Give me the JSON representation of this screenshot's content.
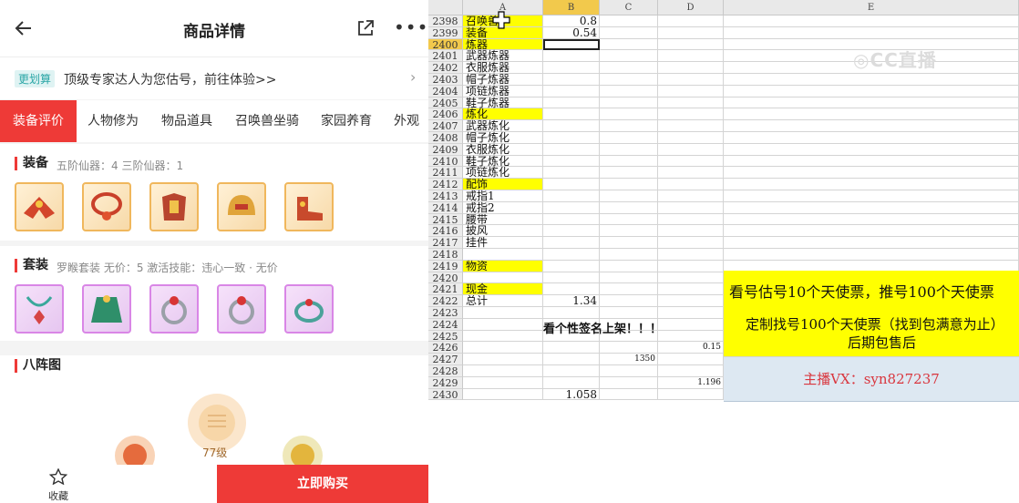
{
  "phone": {
    "header": {
      "title": "商品详情",
      "more": "•••"
    },
    "banner": {
      "tag": "更划算",
      "text": "顶级专家达人为您估号，前往体验>>",
      "arrow": "›"
    },
    "tabs": [
      "装备评价",
      "人物修为",
      "物品道具",
      "召唤兽坐骑",
      "家园养育",
      "外观"
    ],
    "equip": {
      "title": "装备",
      "sub": "五阶仙器：4  三阶仙器：1"
    },
    "suit": {
      "title": "套装",
      "sub": "罗睺套装  无价：5  激活技能：违心一致 · 无价"
    },
    "bagua": {
      "title": "八阵图",
      "level": "77级"
    },
    "bottom": {
      "fav_label": "收藏",
      "buy_label": "立即购买"
    },
    "colors": {
      "accent": "#ee3a37",
      "gold_frame": "#f0b75c",
      "purple_frame": "#d986e6"
    }
  },
  "sheet": {
    "columns": [
      "A",
      "B",
      "C",
      "D",
      "E"
    ],
    "rows": [
      {
        "n": "2398",
        "a": "召唤兽",
        "b": "0.8",
        "yel": true
      },
      {
        "n": "2399",
        "a": "装备",
        "b": "0.54",
        "yel": true
      },
      {
        "n": "2400",
        "a": "炼器",
        "b": "",
        "yel": true
      },
      {
        "n": "2401",
        "a": "武器炼器"
      },
      {
        "n": "2402",
        "a": "衣服炼器"
      },
      {
        "n": "2403",
        "a": "帽子炼器"
      },
      {
        "n": "2404",
        "a": "项链炼器"
      },
      {
        "n": "2405",
        "a": "鞋子炼器"
      },
      {
        "n": "2406",
        "a": "炼化",
        "yel": true
      },
      {
        "n": "2407",
        "a": "武器炼化"
      },
      {
        "n": "2408",
        "a": "帽子炼化"
      },
      {
        "n": "2409",
        "a": "衣服炼化"
      },
      {
        "n": "2410",
        "a": "鞋子炼化"
      },
      {
        "n": "2411",
        "a": "项链炼化"
      },
      {
        "n": "2412",
        "a": "配饰",
        "yel": true
      },
      {
        "n": "2413",
        "a": "戒指1"
      },
      {
        "n": "2414",
        "a": "戒指2"
      },
      {
        "n": "2415",
        "a": "腰带"
      },
      {
        "n": "2416",
        "a": "披风"
      },
      {
        "n": "2417",
        "a": "挂件"
      },
      {
        "n": "2418",
        "a": ""
      },
      {
        "n": "2419",
        "a": "物资",
        "yel": true
      },
      {
        "n": "2420",
        "a": ""
      },
      {
        "n": "2421",
        "a": "现金",
        "yel": true
      },
      {
        "n": "2422",
        "a": "总计",
        "b": "1.34"
      },
      {
        "n": "2423",
        "a": ""
      },
      {
        "n": "2424",
        "a": "",
        "overflow": "看个性签名上架！！！"
      },
      {
        "n": "2425",
        "a": ""
      },
      {
        "n": "2426",
        "a": "",
        "d": "0.15"
      },
      {
        "n": "2427",
        "a": "",
        "c": "1350"
      },
      {
        "n": "2428",
        "a": ""
      },
      {
        "n": "2429",
        "a": "",
        "d": "1.196"
      },
      {
        "n": "2430",
        "a": "",
        "b": "1.058"
      }
    ],
    "merged": {
      "pricing_line1": "看号估号10个天使票，推号100个天使票",
      "pricing_line2": "定制找号100个天使票（找到包满意为止）",
      "pricing_line3": "后期包售后",
      "contact": "主播VX：syn827237"
    },
    "watermark": "◎CC直播",
    "colors": {
      "highlight": "#ffff00",
      "contact_bg": "#dde8f2",
      "contact_text": "#d9363e"
    }
  }
}
